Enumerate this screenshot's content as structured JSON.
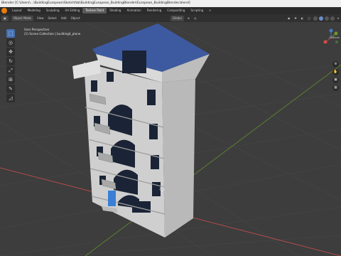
{
  "window": {
    "title": "Blender [C:\\Users\\...\\BuildingEuropean\\Sketchfab\\BuildingEuropean_BuildingBlender\\European_BuildingBlender.blend]"
  },
  "workspace_tabs": [
    "Layout",
    "Modeling",
    "Sculpting",
    "UV Editing",
    "Texture Paint",
    "Shading",
    "Animation",
    "Rendering",
    "Compositing",
    "Scripting",
    "+"
  ],
  "active_tab": "Texture Paint",
  "header": {
    "mode": "Object Mode",
    "menu": [
      "View",
      "Select",
      "Add",
      "Object"
    ],
    "orientation": "Global",
    "options": "Options"
  },
  "viewport": {
    "perspective": "User Perspective",
    "collection": "(1) Scene Collection | building4_plane"
  },
  "tools": [
    "cursor-icon",
    "select-box-icon",
    "move-icon",
    "rotate-icon",
    "scale-icon",
    "transform-icon",
    "annotate-icon",
    "measure-icon"
  ],
  "colors": {
    "wall": "#c9c9c9",
    "roof": "#3d5aa0",
    "window": "#1b2436",
    "door": "#3a7fd6",
    "grid_x": "#b04a4a",
    "grid_y": "#6a9a2a",
    "bg": "#3d3d3d"
  }
}
